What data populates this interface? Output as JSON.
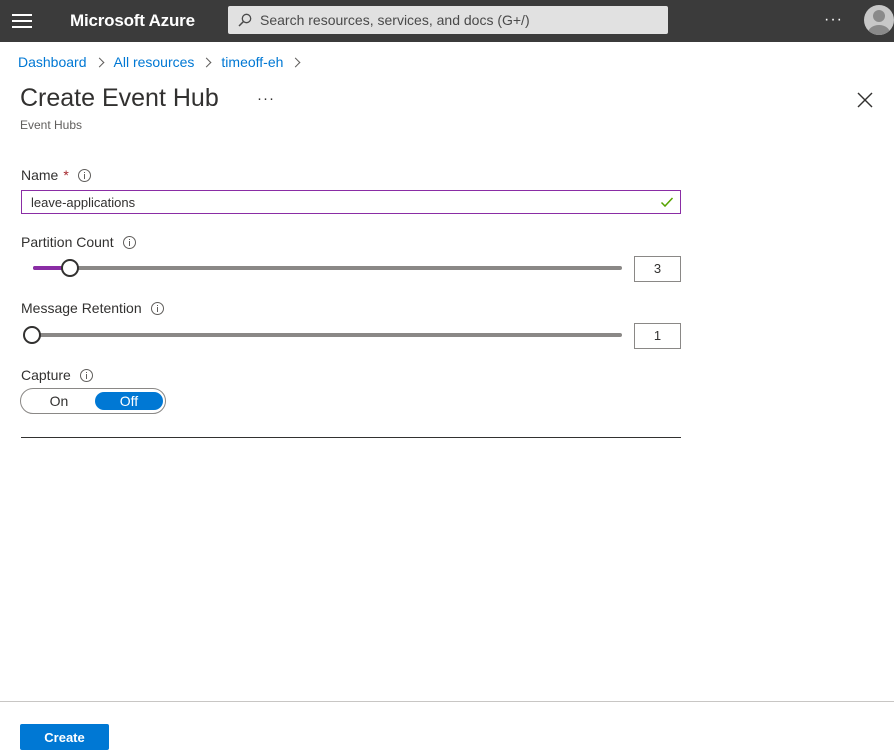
{
  "topbar": {
    "brand": "Microsoft Azure",
    "search_placeholder": "Search resources, services, and docs (G+/)",
    "more_label": "···"
  },
  "breadcrumb": {
    "items": [
      "Dashboard",
      "All resources",
      "timeoff-eh"
    ]
  },
  "page": {
    "title": "Create Event Hub",
    "more_label": "···",
    "subtitle": "Event Hubs"
  },
  "form": {
    "name": {
      "label": "Name",
      "required_mark": "*",
      "value": "leave-applications"
    },
    "partition_count": {
      "label": "Partition Count",
      "value": "3"
    },
    "message_retention": {
      "label": "Message Retention",
      "value": "1"
    },
    "capture": {
      "label": "Capture",
      "on_label": "On",
      "off_label": "Off",
      "selected": "Off"
    }
  },
  "footer": {
    "create_label": "Create"
  },
  "colors": {
    "topbar": "#3b3b3b",
    "accent": "#0078d4",
    "focus": "#8a2da5",
    "valid": "#57a300"
  },
  "icons": [
    "hamburger-icon",
    "search-icon",
    "user-avatar-icon",
    "chevron-right-icon",
    "close-icon",
    "info-icon",
    "checkmark-icon"
  ]
}
